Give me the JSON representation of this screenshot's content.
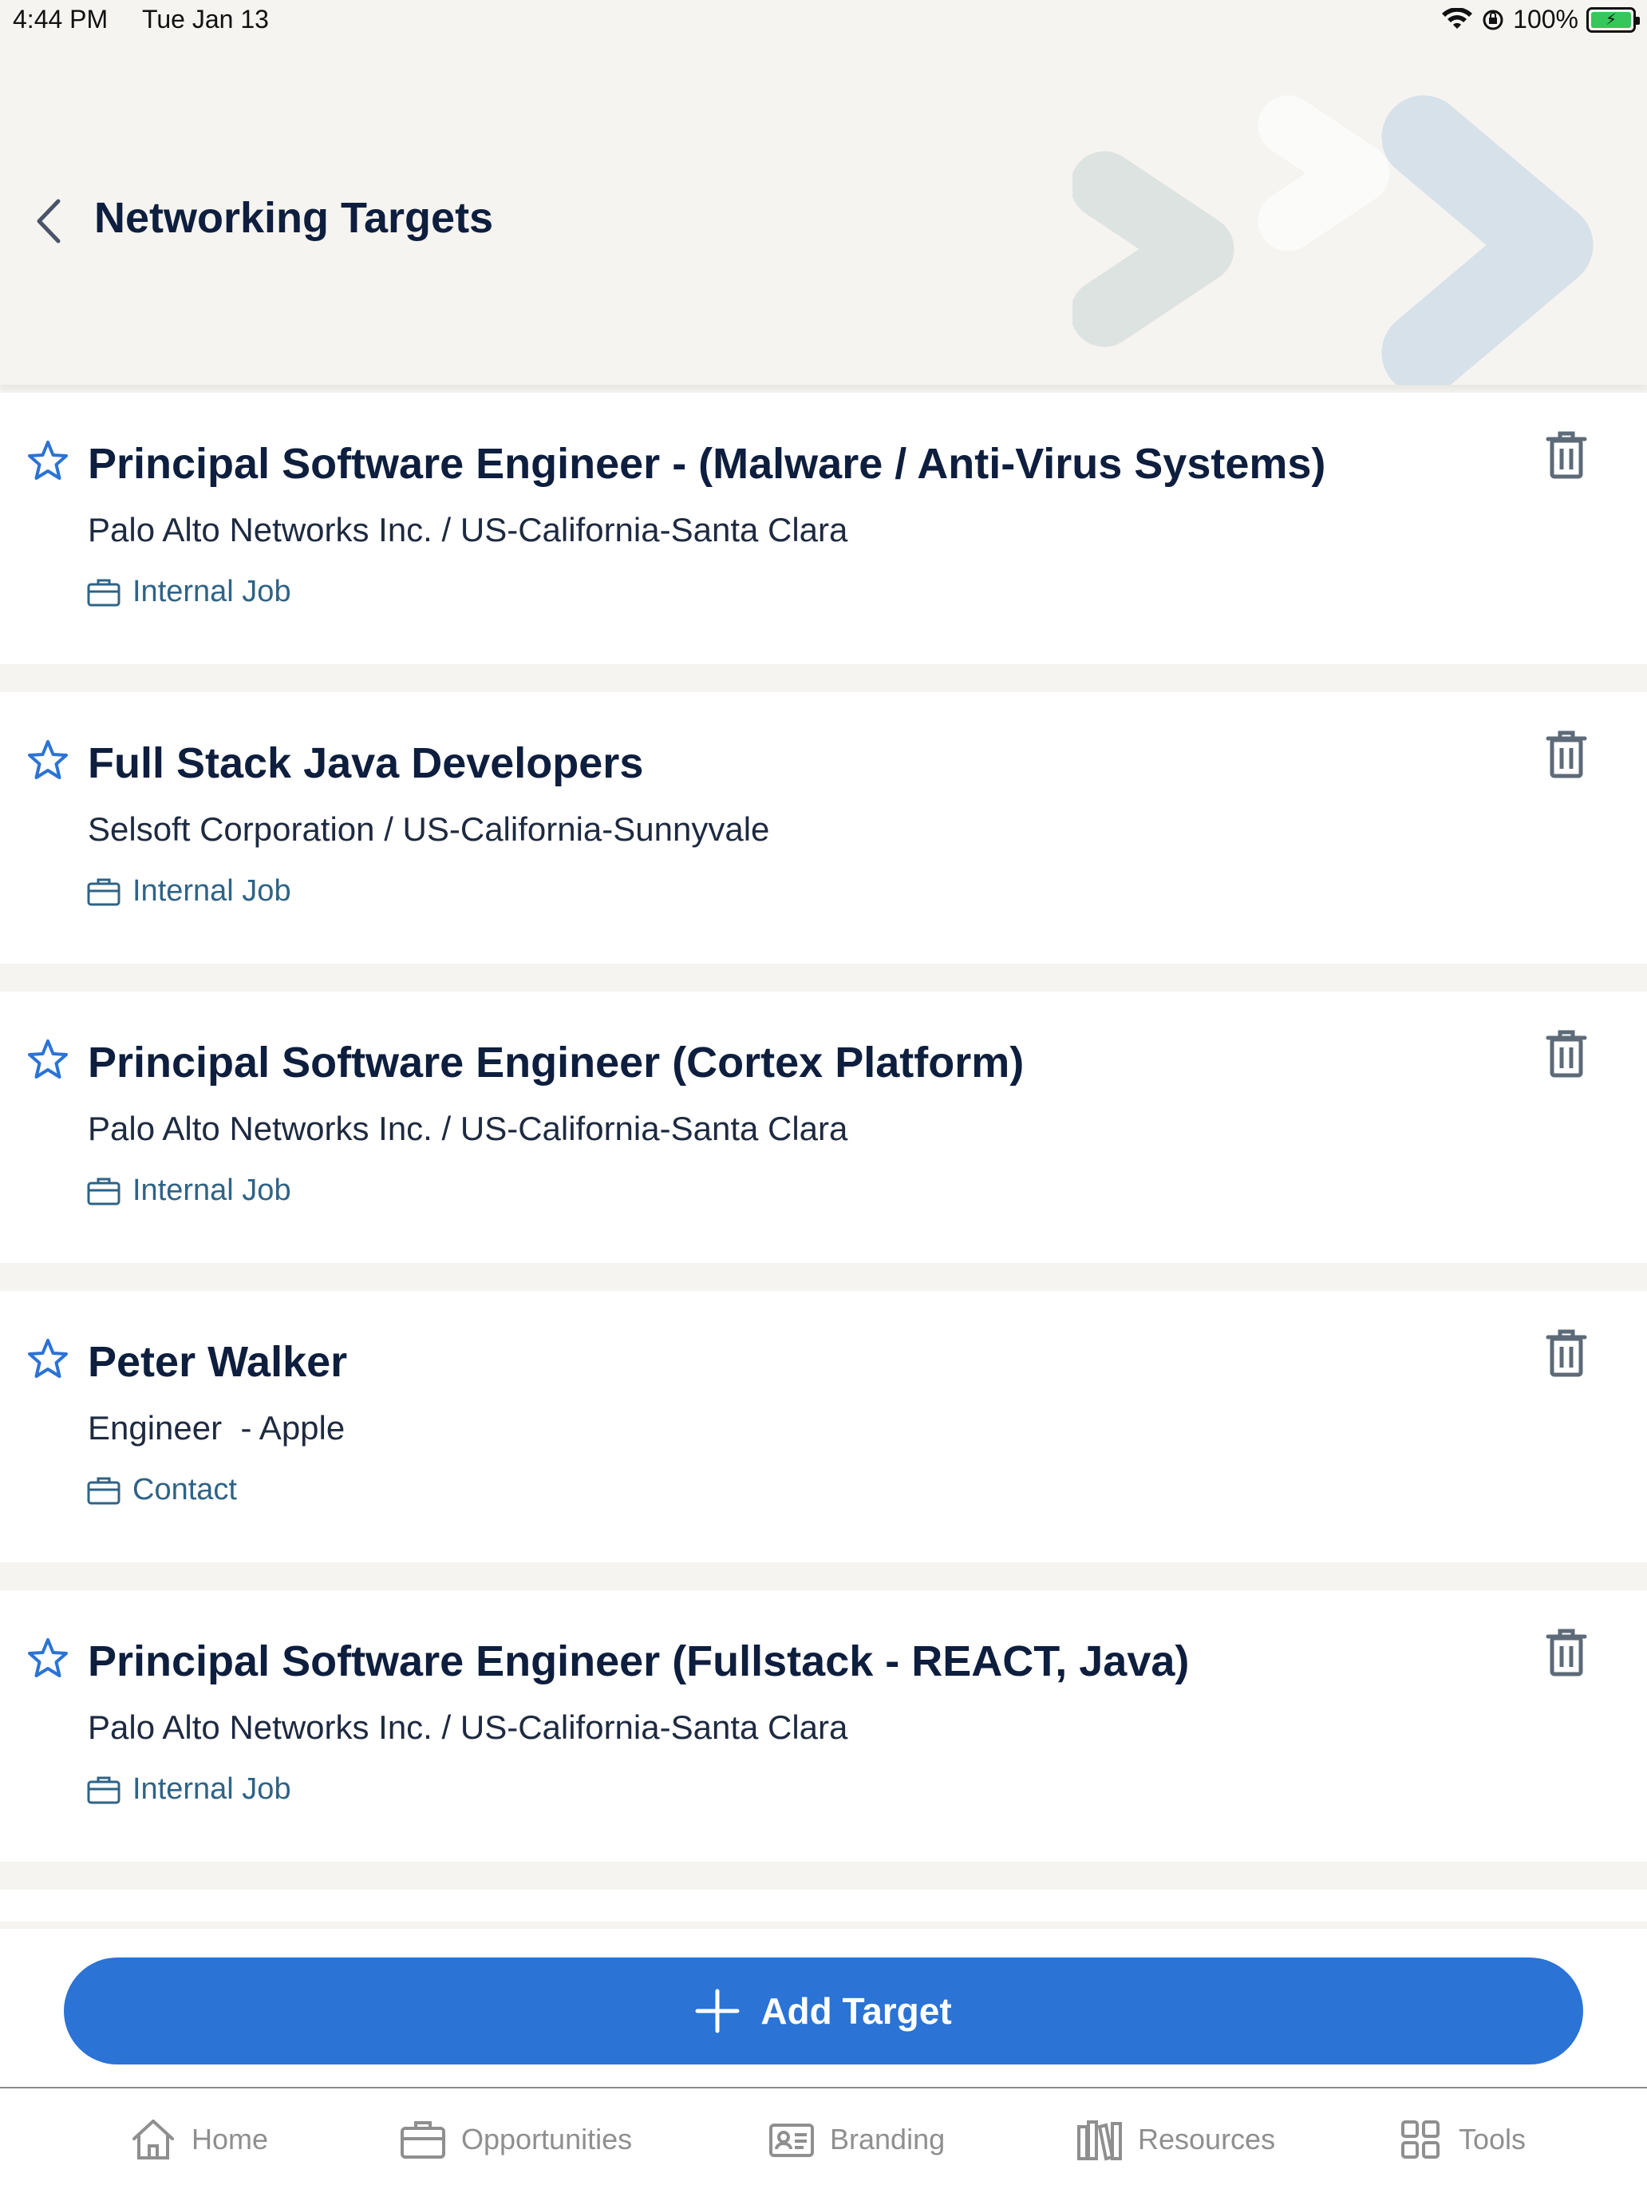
{
  "status_bar": {
    "time": "4:44 PM",
    "date": "Tue Jan 13",
    "battery": "100%"
  },
  "header": {
    "title": "Networking Targets"
  },
  "targets": [
    {
      "title": "Principal Software Engineer - (Malware / Anti-Virus Systems)",
      "subtitle": "Palo Alto Networks Inc. / US-California-Santa Clara",
      "tag": "Internal Job"
    },
    {
      "title": "Full Stack Java Developers",
      "subtitle": "Selsoft Corporation / US-California-Sunnyvale",
      "tag": "Internal Job"
    },
    {
      "title": "Principal Software Engineer (Cortex Platform)",
      "subtitle": "Palo Alto Networks Inc. / US-California-Santa Clara",
      "tag": "Internal Job"
    },
    {
      "title": "Peter Walker",
      "subtitle": "Engineer  - Apple",
      "tag": "Contact"
    },
    {
      "title": "Principal Software Engineer (Fullstack - REACT, Java)",
      "subtitle": "Palo Alto Networks Inc. / US-California-Santa Clara",
      "tag": "Internal Job"
    }
  ],
  "add_button": {
    "label": "Add Target"
  },
  "tabs": [
    {
      "label": "Home",
      "icon": "home-icon"
    },
    {
      "label": "Opportunities",
      "icon": "briefcase-icon"
    },
    {
      "label": "Branding",
      "icon": "id-card-icon"
    },
    {
      "label": "Resources",
      "icon": "books-icon"
    },
    {
      "label": "Tools",
      "icon": "grid-icon"
    }
  ],
  "colors": {
    "accent": "#2b73d4",
    "title": "#0e1e3e",
    "tag": "#2f6386",
    "tab_inactive": "#8f8f8f"
  }
}
